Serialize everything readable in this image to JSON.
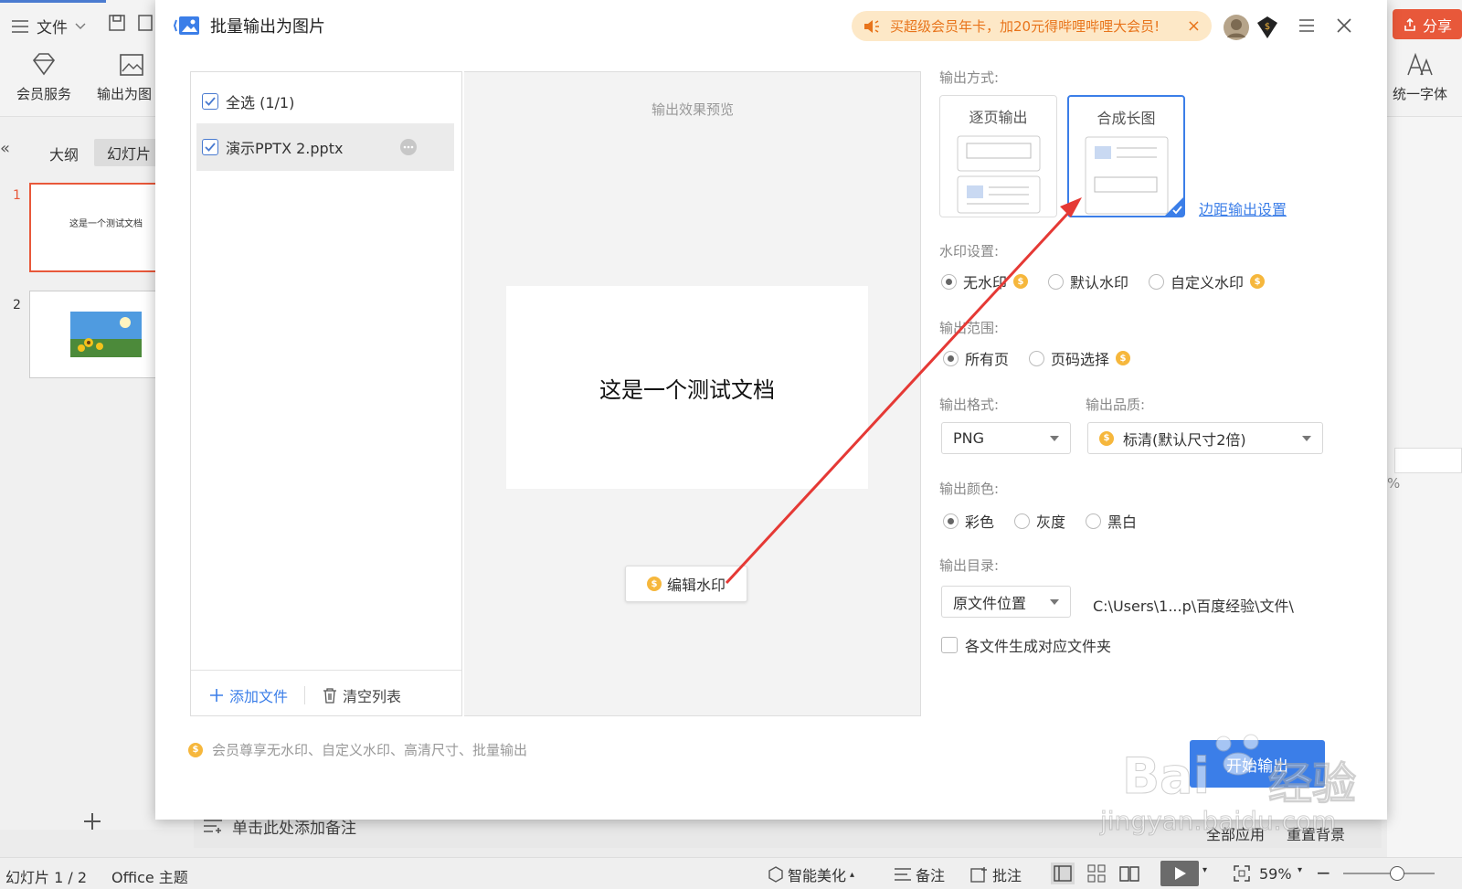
{
  "app": {
    "menu_file": "文件",
    "ribbon_member": "会员服务",
    "ribbon_export": "输出为图",
    "ribbon_font": "统一字体",
    "tab_outline": "大纲",
    "tab_slides": "幻灯片",
    "share": "分享",
    "slide1_num": "1",
    "slide2_num": "2",
    "slide1_text": "这是一个测试文档",
    "notes_placeholder": "单击此处添加备注",
    "apply_all": "全部应用",
    "reset_bg": "重置背景",
    "percent_frag": "%",
    "status": {
      "slide_count": "幻灯片 1 / 2",
      "theme": "Office 主题",
      "beautify": "智能美化",
      "notes": "备注",
      "comment": "批注",
      "zoom": "59%",
      "zoom_fraction": 0.59
    }
  },
  "dialog": {
    "title": "批量输出为图片",
    "promo": "买超级会员年卡，加20元得哔哩哔哩大会员!",
    "file_list": {
      "select_all": "全选 (1/1)",
      "files": [
        {
          "name": "演示PPTX 2.pptx",
          "checked": true
        }
      ],
      "add_file": "添加文件",
      "clear_list": "清空列表"
    },
    "preview": {
      "title": "输出效果预览",
      "slide_text": "这是一个测试文档",
      "edit_watermark": "编辑水印"
    },
    "output_mode": {
      "label": "输出方式:",
      "options": [
        "逐页输出",
        "合成长图"
      ],
      "selected": "合成长图",
      "margin_link": "边距输出设置"
    },
    "watermark": {
      "label": "水印设置:",
      "options": [
        "无水印",
        "默认水印",
        "自定义水印"
      ],
      "selected": "无水印"
    },
    "range": {
      "label": "输出范围:",
      "options": [
        "所有页",
        "页码选择"
      ],
      "selected": "所有页"
    },
    "format": {
      "label": "输出格式:",
      "value": "PNG"
    },
    "quality": {
      "label": "输出品质:",
      "value": "标清(默认尺寸2倍)"
    },
    "color": {
      "label": "输出颜色:",
      "options": [
        "彩色",
        "灰度",
        "黑白"
      ],
      "selected": "彩色"
    },
    "directory": {
      "label": "输出目录:",
      "location": "原文件位置",
      "path": "C:\\Users\\1...p\\百度经验\\文件\\"
    },
    "per_file_folder": "各文件生成对应文件夹",
    "footer_note": "会员尊享无水印、自定义水印、高清尺寸、批量输出",
    "start_button": "开始输出"
  },
  "watermark_overlay": {
    "brand": "Bai",
    "brand2": "经验",
    "url": "jingyan.baidu.com"
  },
  "colors": {
    "accent": "#4a7bd0",
    "promo_text": "#e8741b",
    "promo_bg": "#fde8c7",
    "share": "#e8583a",
    "start_button": "#3b7ee8",
    "arrow": "#e53935"
  }
}
